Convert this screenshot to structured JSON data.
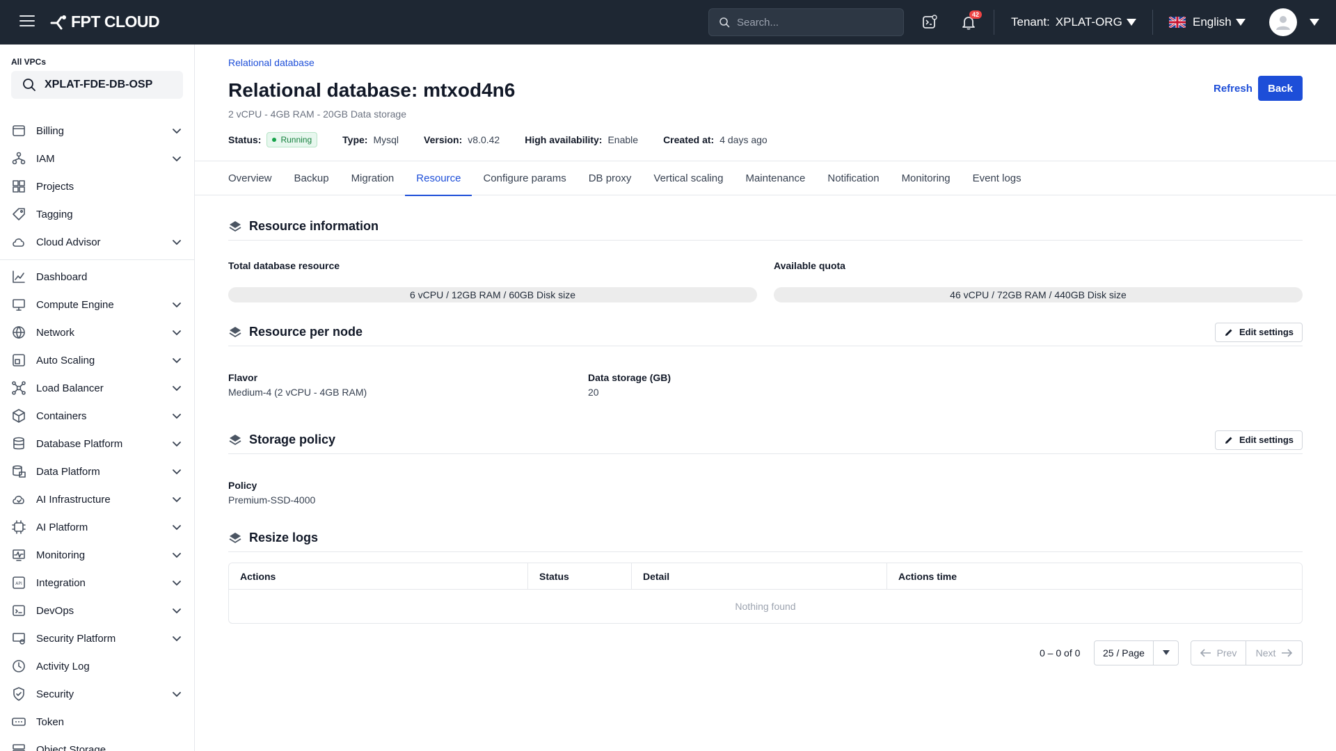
{
  "topbar": {
    "brand": "FPT CLOUD",
    "search_placeholder": "Search...",
    "notification_count": "42",
    "tenant_label": "Tenant:",
    "tenant_value": "XPLAT-ORG",
    "language": "English"
  },
  "sidebar": {
    "vpc_label": "All VPCs",
    "vpc_value": "XPLAT-FDE-DB-OSP",
    "group1": [
      {
        "label": "Billing",
        "icon": "billing-icon",
        "expandable": true
      },
      {
        "label": "IAM",
        "icon": "iam-icon",
        "expandable": true
      },
      {
        "label": "Projects",
        "icon": "projects-icon",
        "expandable": false
      },
      {
        "label": "Tagging",
        "icon": "tag-icon",
        "expandable": false
      },
      {
        "label": "Cloud Advisor",
        "icon": "cloud-advisor-icon",
        "expandable": true
      }
    ],
    "group2": [
      {
        "label": "Dashboard",
        "icon": "dashboard-icon",
        "expandable": false
      },
      {
        "label": "Compute Engine",
        "icon": "compute-icon",
        "expandable": true
      },
      {
        "label": "Network",
        "icon": "network-icon",
        "expandable": true
      },
      {
        "label": "Auto Scaling",
        "icon": "auto-scaling-icon",
        "expandable": true
      },
      {
        "label": "Load Balancer",
        "icon": "load-balancer-icon",
        "expandable": true
      },
      {
        "label": "Containers",
        "icon": "containers-icon",
        "expandable": true
      },
      {
        "label": "Database Platform",
        "icon": "database-icon",
        "expandable": true
      },
      {
        "label": "Data Platform",
        "icon": "data-platform-icon",
        "expandable": true
      },
      {
        "label": "AI Infrastructure",
        "icon": "ai-infra-icon",
        "expandable": true
      },
      {
        "label": "AI Platform",
        "icon": "ai-platform-icon",
        "expandable": true
      },
      {
        "label": "Monitoring",
        "icon": "monitoring-icon",
        "expandable": true
      },
      {
        "label": "Integration",
        "icon": "integration-icon",
        "expandable": true
      },
      {
        "label": "DevOps",
        "icon": "devops-icon",
        "expandable": true
      },
      {
        "label": "Security Platform",
        "icon": "security-platform-icon",
        "expandable": true
      },
      {
        "label": "Activity Log",
        "icon": "activity-log-icon",
        "expandable": false
      },
      {
        "label": "Security",
        "icon": "security-icon",
        "expandable": true
      },
      {
        "label": "Token",
        "icon": "token-icon",
        "expandable": false
      },
      {
        "label": "Object Storage",
        "icon": "object-storage-icon",
        "expandable": false
      }
    ]
  },
  "header": {
    "breadcrumb": "Relational database",
    "title": "Relational database: mtxod4n6",
    "subtitle": "2 vCPU - 4GB RAM - 20GB Data storage",
    "refresh_label": "Refresh",
    "back_label": "Back",
    "status_label": "Status:",
    "status_value": "Running",
    "type_label": "Type:",
    "type_value": "Mysql",
    "version_label": "Version:",
    "version_value": "v8.0.42",
    "ha_label": "High availability:",
    "ha_value": "Enable",
    "created_label": "Created at:",
    "created_value": "4 days ago"
  },
  "tabs": [
    "Overview",
    "Backup",
    "Migration",
    "Resource",
    "Configure params",
    "DB proxy",
    "Vertical scaling",
    "Maintenance",
    "Notification",
    "Monitoring",
    "Event logs"
  ],
  "active_tab": "Resource",
  "resource_info": {
    "title": "Resource information",
    "total_label": "Total database resource",
    "total_value": "6 vCPU / 12GB RAM / 60GB Disk size",
    "quota_label": "Available quota",
    "quota_value": "46 vCPU / 72GB RAM / 440GB Disk size"
  },
  "resource_per_node": {
    "title": "Resource per node",
    "edit_label": "Edit settings",
    "flavor_label": "Flavor",
    "flavor_value": "Medium-4 (2 vCPU - 4GB RAM)",
    "storage_label": "Data storage (GB)",
    "storage_value": "20"
  },
  "storage_policy": {
    "title": "Storage policy",
    "edit_label": "Edit settings",
    "policy_label": "Policy",
    "policy_value": "Premium-SSD-4000"
  },
  "resize_logs": {
    "title": "Resize logs",
    "columns": [
      "Actions",
      "Status",
      "Detail",
      "Actions time"
    ],
    "empty_text": "Nothing found"
  },
  "pagination": {
    "range": "0 – 0 of 0",
    "page_size": "25 / Page",
    "prev": "Prev",
    "next": "Next"
  },
  "colors": {
    "topbar_bg": "#1e2733",
    "accent": "#1d4ed8",
    "running": "#15803d"
  }
}
